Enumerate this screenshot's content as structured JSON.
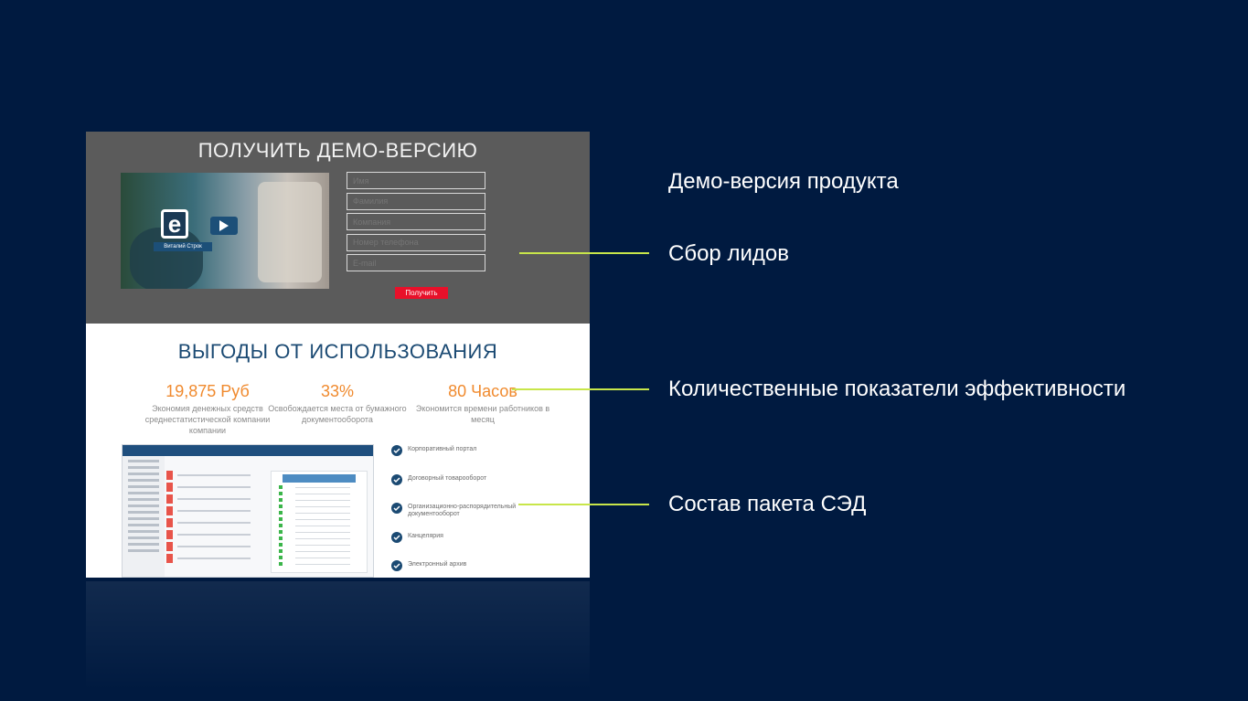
{
  "demo_section": {
    "title": "ПОЛУЧИТЬ ДЕМО-ВЕРСИЮ",
    "video_caption": "Виталий Строк",
    "form_fields": [
      "Имя",
      "Фамилия",
      "Компания",
      "Номер телефона",
      "E-mail"
    ],
    "submit_label": "Получить"
  },
  "benefits_section": {
    "title": "ВЫГОДЫ ОТ ИСПОЛЬЗОВАНИЯ",
    "stats": [
      {
        "value": "19,875 Руб",
        "description": "Экономия денежных средств среднестатистической компании компании"
      },
      {
        "value": "33%",
        "description": "Освобождается места от бумажного документооборота"
      },
      {
        "value": "80 Часов",
        "description": "Экономится времени работников в месяц"
      }
    ],
    "package_items": [
      "Корпоративный портал",
      "Договорный товарооборот",
      "Организационно-распорядительный документооборот",
      "Канцелярия",
      "Электронный архив"
    ]
  },
  "callouts": [
    "Демо-версия продукта",
    "Сбор лидов",
    "Количественные показатели эффективности",
    "Состав пакета СЭД"
  ],
  "colors": {
    "background": "#001a40",
    "accent_line": "#c8e64a",
    "stat_orange": "#f08a2e",
    "title_blue": "#1b4a73",
    "submit_red": "#e8102a"
  }
}
